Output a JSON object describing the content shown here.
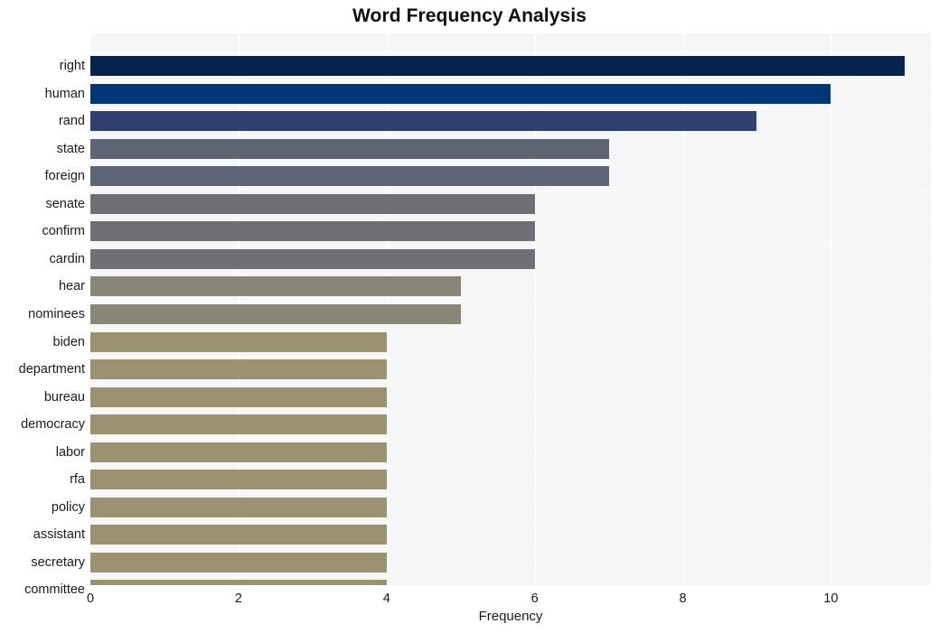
{
  "chart_data": {
    "type": "bar",
    "orientation": "horizontal",
    "title": "Word Frequency Analysis",
    "xlabel": "Frequency",
    "ylabel": "",
    "xlim": [
      0,
      11.35
    ],
    "xticks": [
      0,
      2,
      4,
      6,
      8,
      10
    ],
    "xtick_labels": [
      "0",
      "2",
      "4",
      "6",
      "8",
      "10"
    ],
    "grid": "vertical",
    "legend": "none",
    "plot_background": "#f6f6f7",
    "categories": [
      "right",
      "human",
      "rand",
      "state",
      "foreign",
      "senate",
      "confirm",
      "cardin",
      "hear",
      "nominees",
      "biden",
      "department",
      "bureau",
      "democracy",
      "labor",
      "rfa",
      "policy",
      "assistant",
      "secretary",
      "committee"
    ],
    "values": [
      11,
      10,
      9,
      7,
      7,
      6,
      6,
      6,
      5,
      5,
      4,
      4,
      4,
      4,
      4,
      4,
      4,
      4,
      4,
      4
    ],
    "bar_colors": [
      "#06234d",
      "#033677",
      "#2f4070",
      "#5e6474",
      "#5f6475",
      "#6f7075",
      "#6f7075",
      "#6f7076",
      "#878678",
      "#888777",
      "#9b9272",
      "#9b9272",
      "#9b9272",
      "#9b9272",
      "#9b9272",
      "#9b9272",
      "#9b9272",
      "#9b9272",
      "#9b9272",
      "#9b9272"
    ]
  }
}
